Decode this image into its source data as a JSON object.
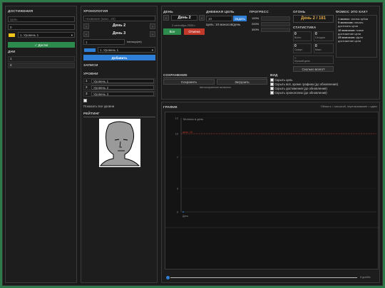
{
  "achievements": {
    "title": "ДОСТИЖЕНИЯ",
    "goal_placeholder": "Цель",
    "count_value": "0",
    "level_select": "1. Уровень 1",
    "add_button": "✓ Достиг",
    "days_title": "ДНИ",
    "days": [
      "1",
      "2"
    ]
  },
  "chronology": {
    "title": "ХРОНОЛОГИЯ",
    "search_placeholder": "Название (макс. 20)",
    "day_a": "День 2",
    "day_b": "День 3",
    "months_value": "1",
    "months_label": "месяца(ев)",
    "level_select": "1. Уровень 1",
    "add_button": "Добавить",
    "records_title": "ЗАПИСИ",
    "levels_title": "УРОВНИ",
    "levels": [
      {
        "num": "1",
        "name": "Уровень 1"
      },
      {
        "num": "2",
        "name": "Уровень 2"
      },
      {
        "num": "3",
        "name": "Уровень 3"
      }
    ],
    "show_all": "Показать все уровни",
    "rating_title": "РЕЙТИНГ"
  },
  "day": {
    "title": "ДЕНЬ",
    "current": "День 2",
    "date": "2 сентября 2026 г.",
    "all_button": "Все",
    "cancel_button": "Отмена"
  },
  "daily_goal": {
    "title": "ДНЕВНАЯ ЦЕЛЬ",
    "value": "10",
    "set_button": "Задать",
    "info": "Цель: 10 моносов/день"
  },
  "progress": {
    "title": "ПРОГРЕСС",
    "rows": [
      {
        "label": "100%",
        "fill": 0
      },
      {
        "label": "200%",
        "fill": 0
      },
      {
        "label": "300%",
        "fill": 0
      }
    ]
  },
  "fire": {
    "title": "ОГОНЬ",
    "value": "День 2 / 181"
  },
  "stats": {
    "title": "СТАТИСТИКА",
    "cells": [
      {
        "value": "0",
        "label": "Всего"
      },
      {
        "value": "0",
        "label": "Сегодня"
      },
      {
        "value": "0",
        "label": "Средн."
      },
      {
        "value": "0",
        "label": "Макс."
      }
    ],
    "best_value": "–",
    "best_label": "Лучший день",
    "how_many_button": "Сколько всего?"
  },
  "faq": {
    "title": "ФОМОС ЭТО КАК?",
    "items": [
      {
        "key": "1 монос:",
        "text": "чистка зубов"
      },
      {
        "key": "5 моносов:",
        "text": "начать достигать цели"
      },
      {
        "key": "10 моносов:",
        "text": "новое достижение цели"
      },
      {
        "key": "25 моносов:",
        "text": "фулл достижение цели"
      }
    ]
  },
  "saving": {
    "title": "СОХРАНЕНИЕ",
    "save_button": "Сохранить",
    "load_button": "Загрузить",
    "note": "Автосохранение включено"
  },
  "view": {
    "title": "ВИД",
    "options": [
      "Скрыть цель",
      "Скрыть всё, кроме графика (до обновления)",
      "Скрыть достижения (до обновления)",
      "Скрыть хронологию (до обновления)"
    ]
  },
  "graph": {
    "title": "ГРАФИК",
    "hint": "Область = масштаб, перетаскивание = сдвиг",
    "inner_label": "Моносы в день",
    "goal_label": "цель: 10",
    "x_tick": "День",
    "slider_label": "5 дней/с",
    "slider_value": 0
  },
  "chart_data": {
    "type": "line",
    "ylim": [
      0,
      12
    ],
    "yticks": [
      0,
      3,
      7,
      10,
      12
    ],
    "x": [
      1
    ],
    "series": [
      {
        "values": [
          0
        ]
      }
    ],
    "goal_line": 10,
    "ylabel": "Моносы в день",
    "xlabel": "День"
  },
  "colors": {
    "accent": "#2e8b4e",
    "red": "#c0392b",
    "blue": "#2f7fd6",
    "fire": "#e0a94a"
  }
}
